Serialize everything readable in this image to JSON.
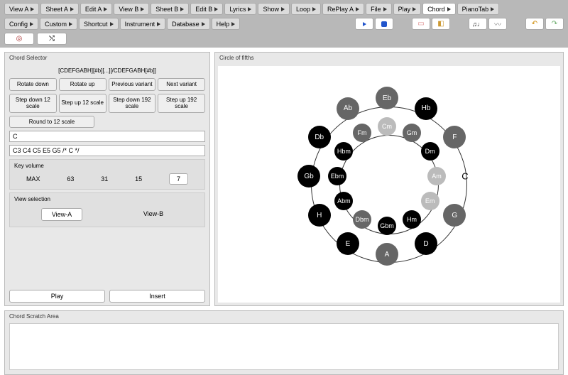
{
  "toolbar": {
    "row1": [
      "View A",
      "Sheet A",
      "Edit A",
      "View B",
      "Sheet B",
      "Edit B",
      "Lyrics",
      "Show",
      "Loop",
      "RePlay A",
      "File",
      "Play",
      "Chord",
      "PianoTab"
    ],
    "active": "Chord",
    "row2": [
      "Config",
      "Custom",
      "Shortcut",
      "Instrument",
      "Database",
      "Help"
    ]
  },
  "chord_selector": {
    "title": "Chord Selector",
    "syntax": "[CDEFGABH][#b][...][/CDEFGABH[#b]]",
    "rotate_down": "Rotate\ndown",
    "rotate_up": "Rotate\nup",
    "prev_variant": "Previous\nvariant",
    "next_variant": "Next\nvariant",
    "step_down_12": "Step down\n12 scale",
    "step_up_12": "Step up\n12 scale",
    "step_down_192": "Step down\n192 scale",
    "step_up_192": "Step up\n192 scale",
    "round": "Round to 12 scale",
    "input1": "C",
    "input2": "C3 C4 C5 E5 G5 /* C */",
    "key_volume": {
      "label": "Key volume",
      "values": [
        "MAX",
        "63",
        "31",
        "15",
        "7"
      ],
      "selected": "7"
    },
    "view_selection": {
      "label": "View selection",
      "a": "View-A",
      "b": "View-B"
    },
    "play": "Play",
    "insert": "Insert"
  },
  "circle": {
    "title": "Circle of fifths",
    "outer": [
      {
        "label": "Eb",
        "angle": -90,
        "shade": "dgray"
      },
      {
        "label": "Hb",
        "angle": -60,
        "shade": "black"
      },
      {
        "label": "F",
        "angle": -30,
        "shade": "dgray"
      },
      {
        "label": "C",
        "angle": 0,
        "shade": "label"
      },
      {
        "label": "G",
        "angle": 30,
        "shade": "dgray"
      },
      {
        "label": "D",
        "angle": 60,
        "shade": "black"
      },
      {
        "label": "A",
        "angle": 90,
        "shade": "dgray"
      },
      {
        "label": "E",
        "angle": 120,
        "shade": "black"
      },
      {
        "label": "H",
        "angle": 150,
        "shade": "black"
      },
      {
        "label": "Gb",
        "angle": 180,
        "shade": "black"
      },
      {
        "label": "Db",
        "angle": 210,
        "shade": "black"
      },
      {
        "label": "Ab",
        "angle": 240,
        "shade": "dgray"
      }
    ],
    "inner": [
      {
        "label": "Cm",
        "angle": -90,
        "shade": "lgray"
      },
      {
        "label": "Gm",
        "angle": -60,
        "shade": "dgray"
      },
      {
        "label": "Dm",
        "angle": -30,
        "shade": "black"
      },
      {
        "label": "Am",
        "angle": 0,
        "shade": "lgray"
      },
      {
        "label": "Em",
        "angle": 30,
        "shade": "lgray"
      },
      {
        "label": "Hm",
        "angle": 60,
        "shade": "black"
      },
      {
        "label": "Gbm",
        "angle": 90,
        "shade": "black"
      },
      {
        "label": "Dbm",
        "angle": 120,
        "shade": "dgray"
      },
      {
        "label": "Abm",
        "angle": 150,
        "shade": "black"
      },
      {
        "label": "Ebm",
        "angle": 180,
        "shade": "black"
      },
      {
        "label": "Hbm",
        "angle": 210,
        "shade": "black"
      },
      {
        "label": "Fm",
        "angle": 240,
        "shade": "dgray"
      }
    ]
  },
  "scratch": {
    "title": "Chord Scratch Area"
  }
}
